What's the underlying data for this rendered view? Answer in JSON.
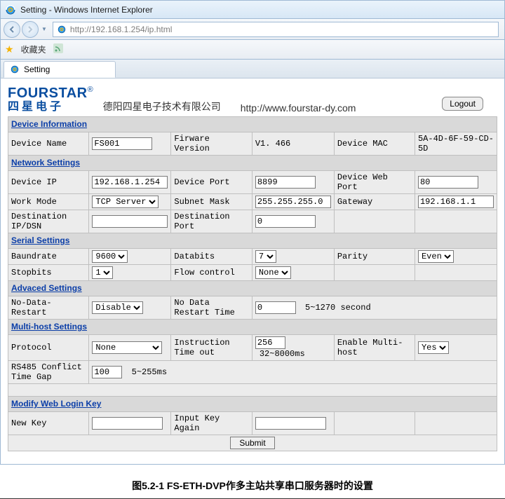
{
  "window": {
    "title": "Setting - Windows Internet Explorer"
  },
  "url": "http://192.168.1.254/ip.html",
  "favorites_label": "收藏夹",
  "tab": {
    "label": "Setting"
  },
  "brand": {
    "name": "FOURSTAR",
    "reg": "®",
    "cn": "四星电子",
    "company": "德阳四星电子技术有限公司",
    "url": "http://www.fourstar-dy.com",
    "logout": "Logout"
  },
  "sections": {
    "device_info": "Device Information",
    "network": "Network Settings",
    "serial": "Serial Settings",
    "advanced": "Advaced Settings",
    "multihost": "Multi-host Settings",
    "modifykey": "Modify Web Login Key"
  },
  "labels": {
    "device_name": "Device Name",
    "firmware_version": "Firware Version",
    "device_mac": "Device MAC",
    "device_ip": "Device IP",
    "device_port": "Device Port",
    "device_web_port": "Device Web Port",
    "work_mode": "Work Mode",
    "subnet_mask": "Subnet Mask",
    "gateway": "Gateway",
    "dest_ip": "Destination IP/DSN",
    "dest_port": "Destination Port",
    "baudrate": "Baundrate",
    "databits": "Databits",
    "parity": "Parity",
    "stopbits": "Stopbits",
    "flow": "Flow control",
    "no_data_restart": "No-Data-Restart",
    "no_data_time": "No Data Restart Time",
    "no_data_hint": "5~1270 second",
    "protocol": "Protocol",
    "instruction_timeout": "Instruction Time out",
    "instruction_hint": "32~8000ms",
    "enable_multi": "Enable Multi-host",
    "rs485_gap": "RS485 Conflict Time Gap",
    "rs485_hint": "5~255ms",
    "new_key": "New Key",
    "key_again": "Input Key Again",
    "submit": "Submit"
  },
  "values": {
    "device_name": "FS001",
    "firmware_version": "V1. 466",
    "device_mac": "5A-4D-6F-59-CD-5D",
    "device_ip": "192.168.1.254",
    "device_port": "8899",
    "device_web_port": "80",
    "work_mode": "TCP Server",
    "subnet_mask": "255.255.255.0",
    "gateway": "192.168.1.1",
    "dest_ip": "",
    "dest_port": "0",
    "baudrate": "9600",
    "databits": "7",
    "parity": "Even",
    "stopbits": "1",
    "flow": "None",
    "no_data_restart": "Disable",
    "no_data_time": "0",
    "protocol": "None",
    "instruction_timeout": "256",
    "enable_multi": "Yes",
    "rs485_gap": "100",
    "new_key": "",
    "key_again": ""
  },
  "caption": "图5.2-1 FS-ETH-DVP作多主站共享串口服务器时的设置"
}
